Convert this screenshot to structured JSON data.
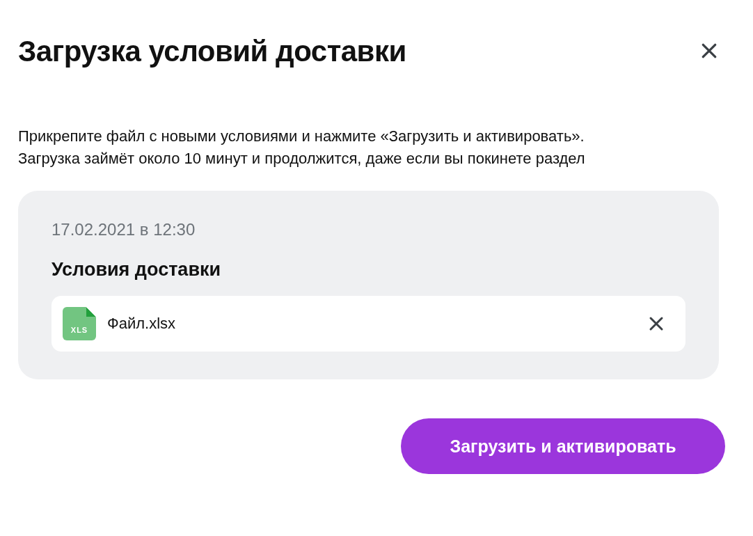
{
  "dialog": {
    "title": "Загрузка условий доставки",
    "description": "Прикрепите файл с новыми условиями и нажмите «Загрузить и активировать». Загрузка займёт около 10 минут и продолжится, даже если вы покинете раздел"
  },
  "upload": {
    "date": "17.02.2021 в 12:30",
    "heading": "Условия доставки",
    "file": {
      "badge": "XLS",
      "name": "Файл.xlsx"
    }
  },
  "primary_button": "Загрузить и активировать"
}
